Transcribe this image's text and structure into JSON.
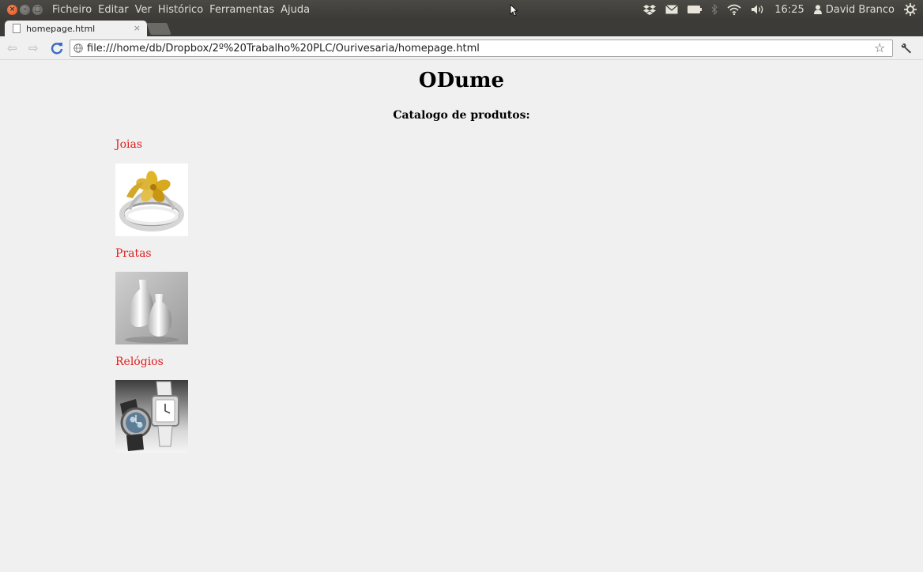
{
  "menubar": {
    "items": [
      "Ficheiro",
      "Editar",
      "Ver",
      "Histórico",
      "Ferramentas",
      "Ajuda"
    ],
    "clock": "16:25",
    "user": "David Branco"
  },
  "tab": {
    "title": "homepage.html",
    "close": "×"
  },
  "navbar": {
    "url": "file:///home/db/Dropbox/2º%20Trabalho%20PLC/Ourivesaria/homepage.html"
  },
  "page": {
    "title": "ODume",
    "subtitle": "Catalogo de produtos:",
    "categories": [
      {
        "label": "Joias",
        "image": "ring-image"
      },
      {
        "label": "Pratas",
        "image": "silver-vases-image"
      },
      {
        "label": "Relógios",
        "image": "watches-image"
      }
    ]
  },
  "colors": {
    "link": "#e21c1c",
    "page_bg": "#f0f0f0",
    "topbar_bg": "#3c3b37"
  }
}
